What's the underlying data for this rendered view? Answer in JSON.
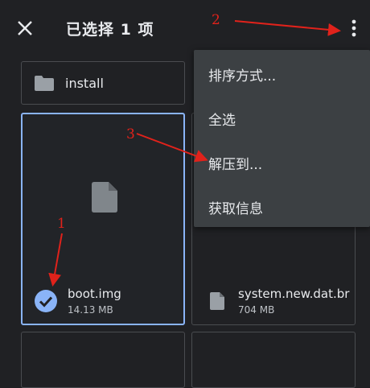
{
  "header": {
    "title": "已选择 1 项"
  },
  "folder": {
    "name": "install"
  },
  "files": [
    {
      "name": "boot.img",
      "size": "14.13 MB"
    },
    {
      "name": "system.new.dat.br",
      "size": "704 MB"
    }
  ],
  "menu": {
    "items": [
      "排序方式...",
      "全选",
      "解压到...",
      "获取信息"
    ]
  },
  "annotations": {
    "n1": "1",
    "n2": "2",
    "n3": "3"
  },
  "colors": {
    "background": "#202124",
    "accent": "#8ab4f8",
    "menu_bg": "#3c4043",
    "annotation": "#e0221b"
  }
}
